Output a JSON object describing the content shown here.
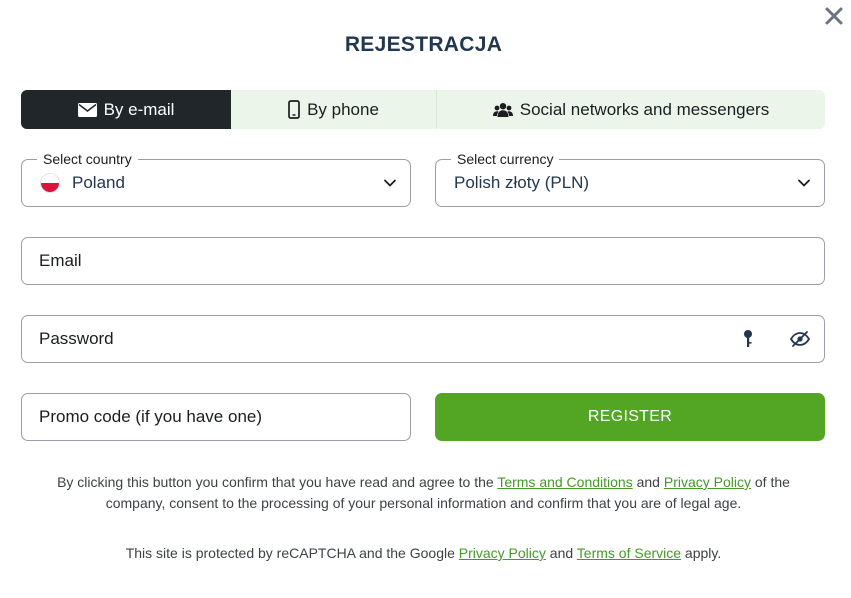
{
  "title": "REJESTRACJA",
  "tabs": [
    {
      "label": "By e-mail",
      "icon": "envelope-icon",
      "active": true
    },
    {
      "label": "By phone",
      "icon": "phone-icon",
      "active": false
    },
    {
      "label": "Social networks and messengers",
      "icon": "users-icon",
      "active": false
    }
  ],
  "country": {
    "label": "Select country",
    "value": "Poland",
    "flag": "poland-flag"
  },
  "currency": {
    "label": "Select currency",
    "value": "Polish złoty (PLN)"
  },
  "email": {
    "placeholder": "Email"
  },
  "password": {
    "placeholder": "Password"
  },
  "promo": {
    "placeholder": "Promo code (if you have one)"
  },
  "register_label": "REGISTER",
  "consent": {
    "prefix": "By clicking this button you confirm that you have read and agree to the ",
    "terms_link": "Terms and Conditions",
    "and": " and ",
    "privacy_link": "Privacy Policy",
    "suffix": " of the company, consent to the processing of your personal information and confirm that you are of legal age."
  },
  "recaptcha": {
    "prefix": "This site is protected by reCAPTCHA and the Google ",
    "privacy_link": "Privacy Policy",
    "and": " and ",
    "tos_link": "Terms of Service",
    "suffix": " apply."
  },
  "colors": {
    "accent_green": "#53a624",
    "link_green": "#46982a",
    "title_navy": "#23374f",
    "active_tab": "#202629",
    "tab_bg": "#ecf5e9"
  }
}
